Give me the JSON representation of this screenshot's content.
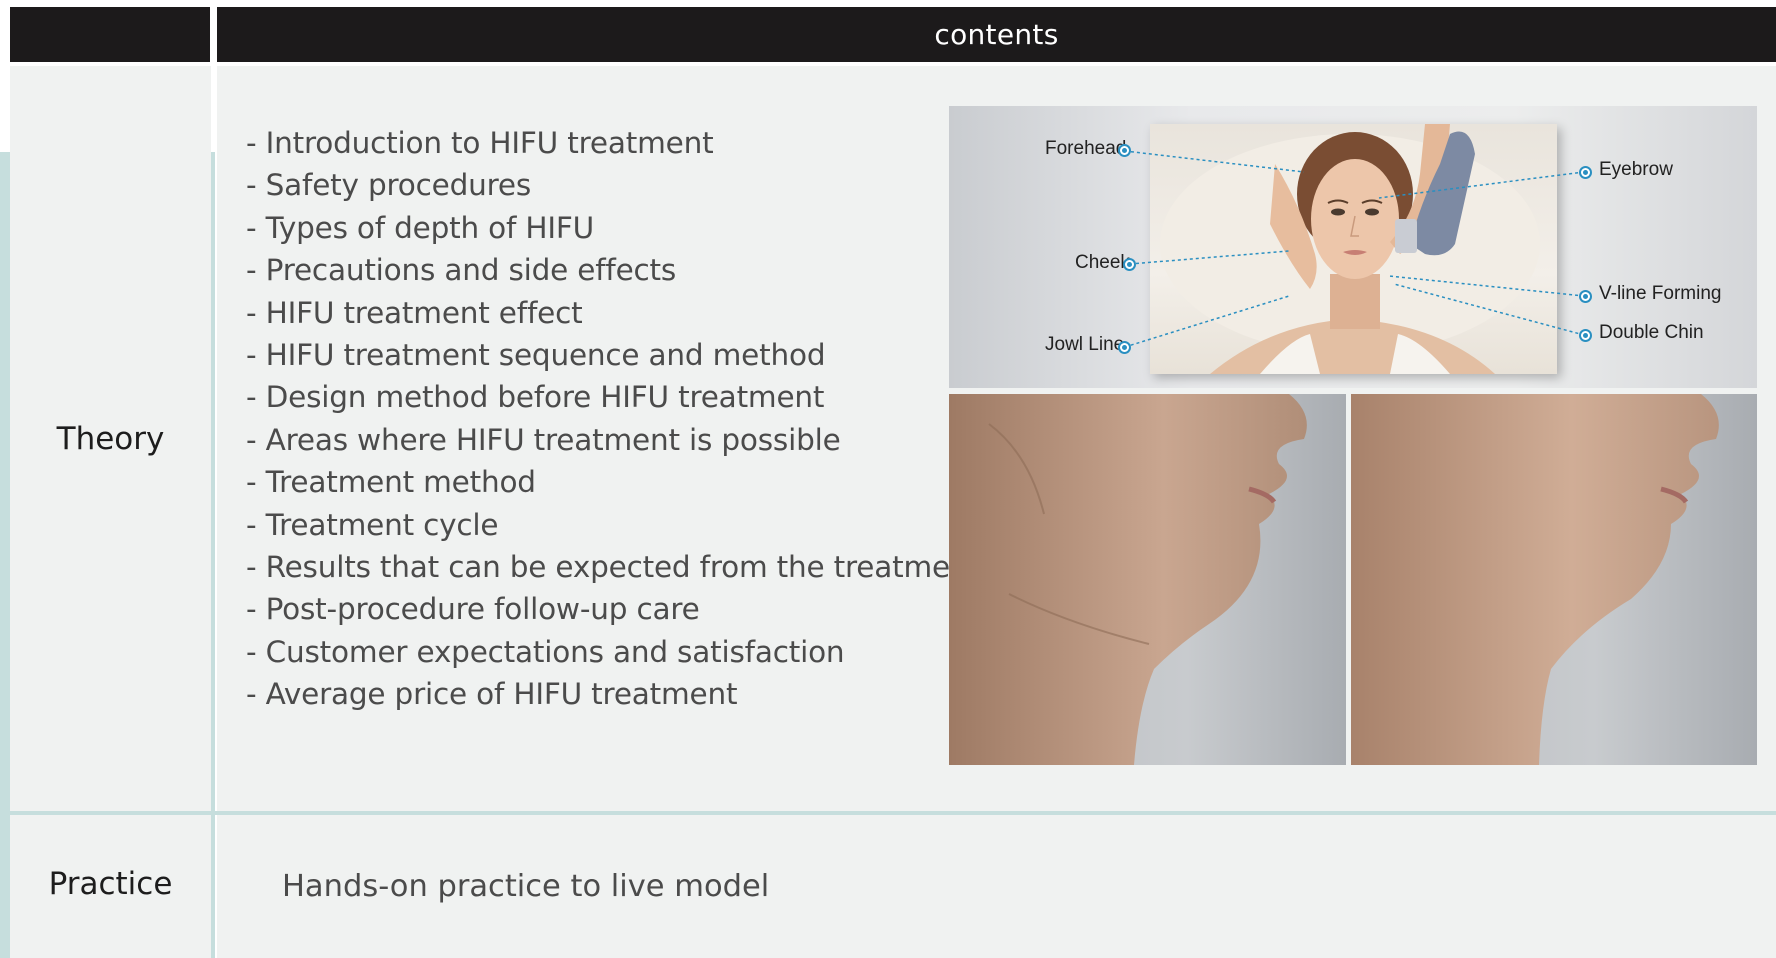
{
  "header": {
    "title": "contents"
  },
  "rows": {
    "theory": {
      "label": "Theory",
      "topics": [
        "- Introduction to HIFU treatment",
        "- Safety procedures",
        "- Types of depth of HIFU",
        "- Precautions and side effects",
        "- HIFU treatment effect",
        "- HIFU treatment sequence and method",
        "- Design method before HIFU treatment",
        "- Areas where HIFU treatment is possible",
        "- Treatment method",
        "- Treatment cycle",
        "- Results that can be expected from the treatment",
        "- Post-procedure follow-up care",
        "- Customer expectations and satisfaction",
        "- Average price of HIFU treatment"
      ]
    },
    "practice": {
      "label": "Practice",
      "text": "Hands-on practice to live model"
    }
  },
  "diagram": {
    "labels": {
      "forehead": "Forehead",
      "cheek": "Cheek",
      "jowl_line": "Jowl Line",
      "eyebrow": "Eyebrow",
      "v_line": "V-line Forming",
      "double_chin": "Double Chin"
    },
    "line_color": "#2a8fc1"
  },
  "colors": {
    "header_bg": "#1c1a1b",
    "cell_bg": "#f0f2f1",
    "divider": "#c6dedd",
    "text": "#4b4b4b"
  }
}
